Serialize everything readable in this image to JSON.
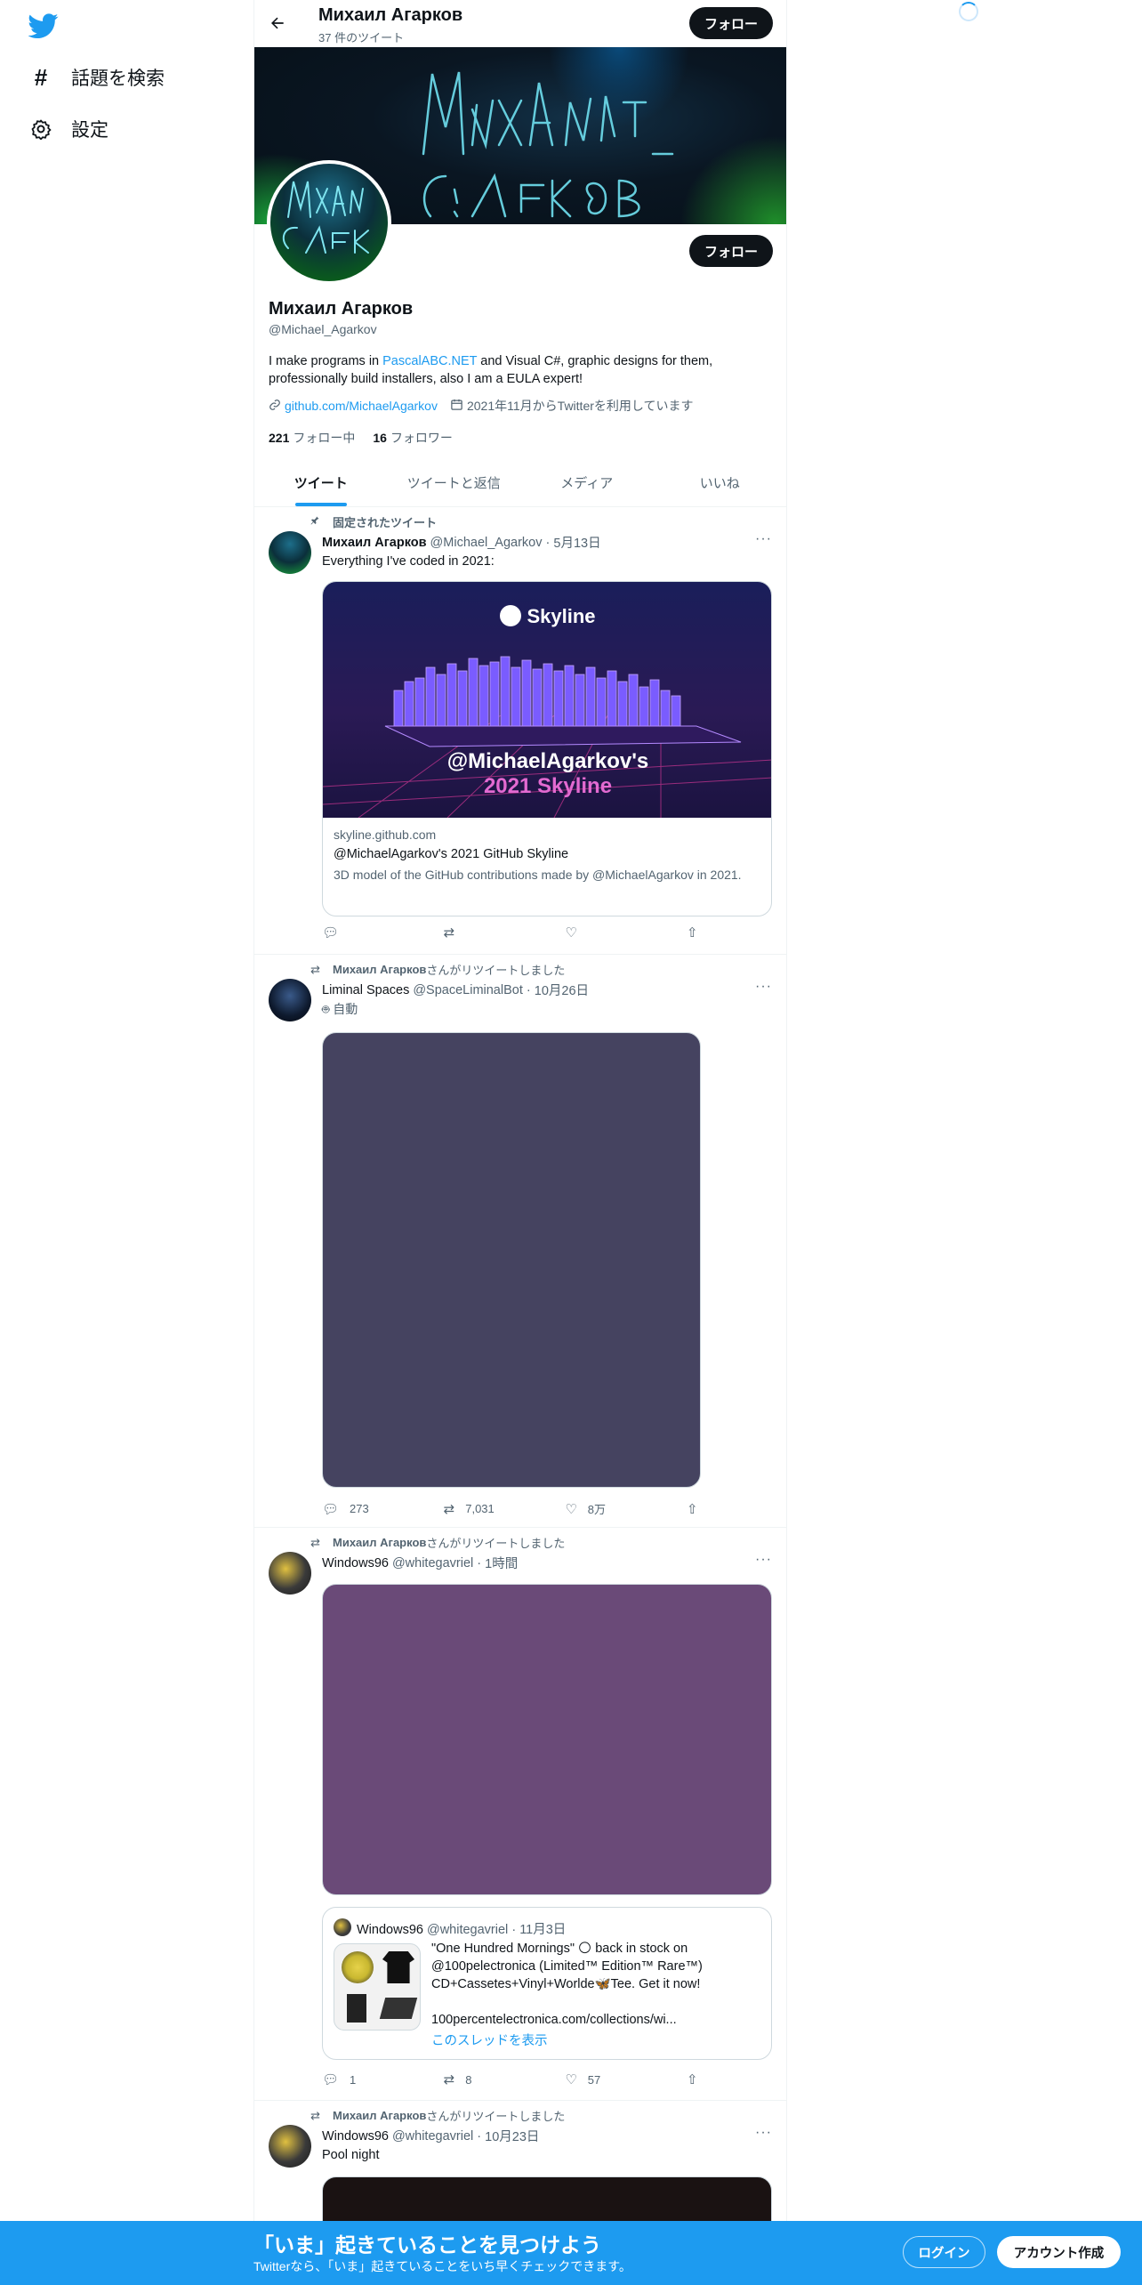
{
  "nav": {
    "explore_label": "話題を検索",
    "settings_label": "設定"
  },
  "header": {
    "name": "Михаил Агарков",
    "tweet_count": "37 件のツイート",
    "follow_label": "フォロー"
  },
  "profile": {
    "name": "Михаил Агарков",
    "handle": "@Michael_Agarkov",
    "bio_part1": "I make programs in ",
    "bio_link": "PascalABC.NET",
    "bio_part2": " and Visual C#, graphic designs for them, professionally build installers, also I am a EULA expert!",
    "website": "github.com/MichaelAgarkov",
    "joined": "2021年11月からTwitterを利用しています",
    "following_count": "221",
    "following_label": "フォロー中",
    "followers_count": "16",
    "followers_label": "フォロワー",
    "follow_label": "フォロー"
  },
  "tabs": [
    {
      "label": "ツイート",
      "active": true
    },
    {
      "label": "ツイートと返信",
      "active": false
    },
    {
      "label": "メディア",
      "active": false
    },
    {
      "label": "いいね",
      "active": false
    }
  ],
  "tweets": [
    {
      "context": "固定されたツイート",
      "name": "Михаил Агарков",
      "handle": "@Michael_Agarkov",
      "date": "5月13日",
      "text": "Everything I've coded in 2021:",
      "card": {
        "image_title": "Skyline",
        "image_handle": "@MichaelAgarkov's",
        "image_year": "2021 Skyline",
        "domain": "skyline.github.com",
        "title": "@MichaelAgarkov's 2021 GitHub Skyline",
        "description": "3D model of the GitHub contributions made by @MichaelAgarkov in 2021."
      },
      "replies": "",
      "retweets": "",
      "likes": ""
    },
    {
      "context_name": "Михаил Агарков",
      "context_suffix": "さんがリツイートしました",
      "name": "Liminal Spaces",
      "handle": "@SpaceLiminalBot",
      "date": "10月26日",
      "automated": "自動",
      "media_color": "#454360",
      "replies": "273",
      "retweets": "7,031",
      "likes": "8万"
    },
    {
      "context_name": "Михаил Агарков",
      "context_suffix": "さんがリツイートしました",
      "name": "Windows96",
      "handle": "@whitegavriel",
      "date": "1時間",
      "media_color": "#6a4a78",
      "quote": {
        "name": "Windows96",
        "handle": "@whitegavriel",
        "date": "11月3日",
        "text1": "\"One Hundred Mornings\" 🌕 back in stock on @100pelectronica (Limited™ Edition™ Rare™) CD+Cassetes+Vinyl+Worlde🦋Tee. Get it now!",
        "text2": "100percentelectronica.com/collections/wi...",
        "thread": "このスレッドを表示"
      },
      "replies": "1",
      "retweets": "8",
      "likes": "57"
    },
    {
      "context_name": "Михаил Агарков",
      "context_suffix": "さんがリツイートしました",
      "name": "Windows96",
      "handle": "@whitegavriel",
      "date": "10月23日",
      "text": "Pool night"
    }
  ],
  "signup": {
    "title": "「いま」起きていることを見つけよう",
    "subtitle": "Twitterなら、「いま」起きていることをいち早くチェックできます。",
    "login": "ログイン",
    "create": "アカウント作成"
  },
  "colors": {
    "accent": "#1d9bf0",
    "text": "#0f1419",
    "muted": "#536471"
  }
}
